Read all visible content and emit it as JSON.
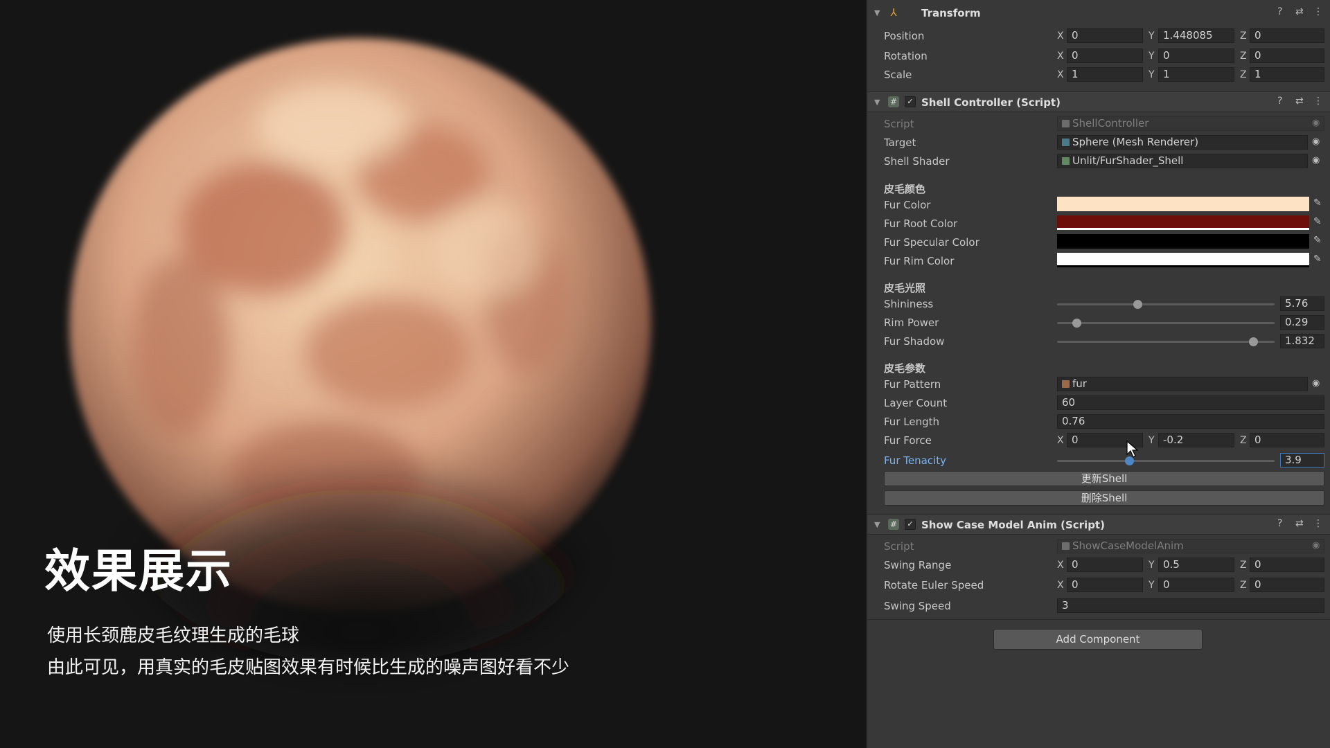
{
  "caption": {
    "title": "效果展示",
    "line1": "使用长颈鹿皮毛纹理生成的毛球",
    "line2": "由此可见，用真实的毛皮贴图效果有时候比生成的噪声图好看不少"
  },
  "transform": {
    "title": "Transform",
    "icon": "transform-axes-icon",
    "position": {
      "label": "Position",
      "x": "0",
      "y": "1.448085",
      "z": "0"
    },
    "rotation": {
      "label": "Rotation",
      "x": "0",
      "y": "0",
      "z": "0"
    },
    "scale": {
      "label": "Scale",
      "x": "1",
      "y": "1",
      "z": "1"
    }
  },
  "axes": {
    "x": "X",
    "y": "Y",
    "z": "Z"
  },
  "header_buttons": {
    "help": "?",
    "settings": "⇄",
    "more": "⋮"
  },
  "shell_controller": {
    "title": "Shell Controller (Script)",
    "script": {
      "label": "Script",
      "value": "ShellController"
    },
    "target": {
      "label": "Target",
      "value": "Sphere (Mesh Renderer)"
    },
    "shell_shader": {
      "label": "Shell Shader",
      "value": "Unlit/FurShader_Shell"
    },
    "section_color": "皮毛颜色",
    "fur_color": {
      "label": "Fur Color",
      "hex": "#fde3c4"
    },
    "fur_root_color": {
      "label": "Fur Root Color",
      "hex": "#6e0e0a"
    },
    "fur_specular_color": {
      "label": "Fur Specular Color",
      "hex": "#000000"
    },
    "fur_rim_color": {
      "label": "Fur Rim Color",
      "hex": "#ffffff"
    },
    "section_lighting": "皮毛光照",
    "shininess": {
      "label": "Shininess",
      "value": "5.76",
      "fraction": 0.37
    },
    "rim_power": {
      "label": "Rim Power",
      "value": "0.29",
      "fraction": 0.09
    },
    "fur_shadow": {
      "label": "Fur Shadow",
      "value": "1.832",
      "fraction": 0.9
    },
    "section_params": "皮毛参数",
    "fur_pattern": {
      "label": "Fur Pattern",
      "value": "fur"
    },
    "layer_count": {
      "label": "Layer Count",
      "value": "60"
    },
    "fur_length": {
      "label": "Fur Length",
      "value": "0.76"
    },
    "fur_force": {
      "label": "Fur Force",
      "x": "0",
      "y": "-0.2",
      "z": "0"
    },
    "fur_tenacity": {
      "label": "Fur Tenacity",
      "value": "3.9",
      "fraction": 0.33
    },
    "update_button": "更新Shell",
    "delete_button": "删除Shell"
  },
  "showcase": {
    "title": "Show Case Model Anim (Script)",
    "script": {
      "label": "Script",
      "value": "ShowCaseModelAnim"
    },
    "swing_range": {
      "label": "Swing Range",
      "x": "0",
      "y": "0.5",
      "z": "0"
    },
    "rotate_euler_speed": {
      "label": "Rotate Euler Speed",
      "x": "0",
      "y": "0",
      "z": "0"
    },
    "swing_speed": {
      "label": "Swing Speed",
      "value": "3"
    }
  },
  "add_component": "Add Component",
  "colors": {
    "inspector_bg": "#383838",
    "field_bg": "#2a2a2a",
    "accent": "#4e86c4",
    "fur_light": "#f3cfa6",
    "fur_dark": "#a2563c"
  }
}
